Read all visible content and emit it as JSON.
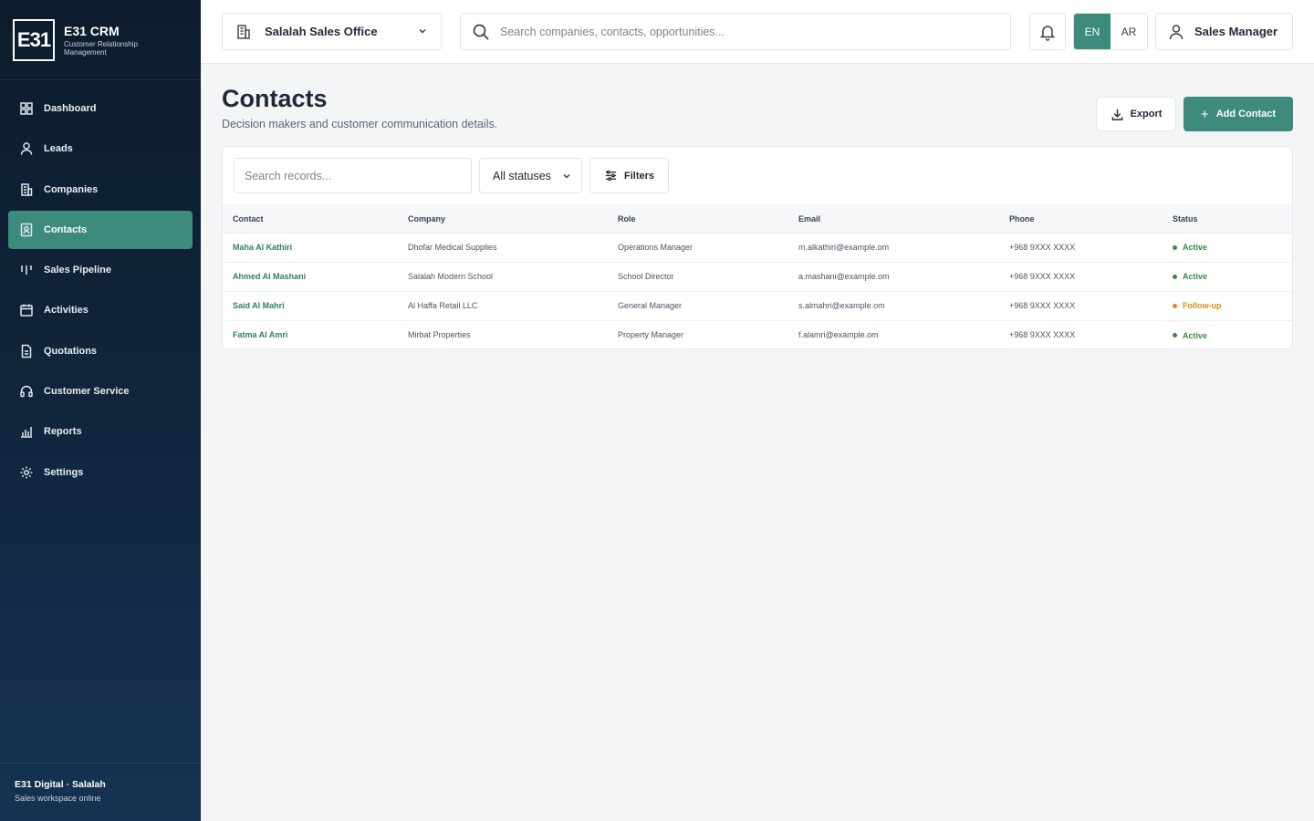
{
  "app": {
    "logo_text": "E31",
    "name": "E31 CRM",
    "subtitle": "Customer Relationship Management"
  },
  "sidebar": {
    "items": [
      {
        "label": "Dashboard",
        "icon": "grid-icon",
        "active": false
      },
      {
        "label": "Leads",
        "icon": "user-icon",
        "active": false
      },
      {
        "label": "Companies",
        "icon": "building-icon",
        "active": false
      },
      {
        "label": "Contacts",
        "icon": "contact-card-icon",
        "active": true
      },
      {
        "label": "Sales Pipeline",
        "icon": "pipeline-icon",
        "active": false
      },
      {
        "label": "Activities",
        "icon": "calendar-icon",
        "active": false
      },
      {
        "label": "Quotations",
        "icon": "document-icon",
        "active": false
      },
      {
        "label": "Customer Service",
        "icon": "headset-icon",
        "active": false
      },
      {
        "label": "Reports",
        "icon": "chart-icon",
        "active": false
      },
      {
        "label": "Settings",
        "icon": "gear-icon",
        "active": false
      }
    ],
    "footer": {
      "title": "E31 Digital · Salalah",
      "subtitle": "Sales workspace online"
    }
  },
  "topbar": {
    "office": "Salalah Sales Office",
    "search_placeholder": "Search companies, contacts, opportunities...",
    "lang_en": "EN",
    "lang_ar": "AR",
    "user": "Sales Manager"
  },
  "page": {
    "title": "Contacts",
    "subtitle": "Decision makers and customer communication details.",
    "export_label": "Export",
    "add_label": "Add Contact"
  },
  "toolbar": {
    "search_placeholder": "Search records...",
    "status_filter": "All statuses",
    "filters_label": "Filters"
  },
  "table": {
    "columns": [
      "Contact",
      "Company",
      "Role",
      "Email",
      "Phone",
      "Status"
    ],
    "rows": [
      {
        "contact": "Maha Al Kathiri",
        "company": "Dhofar Medical Supplies",
        "role": "Operations Manager",
        "email": "m.alkathiri@example.om",
        "phone": "+968 9XXX XXXX",
        "status": "Active"
      },
      {
        "contact": "Ahmed Al Mashani",
        "company": "Salalah Modern School",
        "role": "School Director",
        "email": "a.mashani@example.om",
        "phone": "+968 9XXX XXXX",
        "status": "Active"
      },
      {
        "contact": "Said Al Mahri",
        "company": "Al Haffa Retail LLC",
        "role": "General Manager",
        "email": "s.almahri@example.om",
        "phone": "+968 9XXX XXXX",
        "status": "Follow-up"
      },
      {
        "contact": "Fatma Al Amri",
        "company": "Mirbat Properties",
        "role": "Property Manager",
        "email": "f.alamri@example.om",
        "phone": "+968 9XXX XXXX",
        "status": "Active"
      }
    ]
  },
  "colors": {
    "accent": "#3c8b7c",
    "status_active": "#3a8a3f",
    "status_followup": "#d98b1a"
  }
}
